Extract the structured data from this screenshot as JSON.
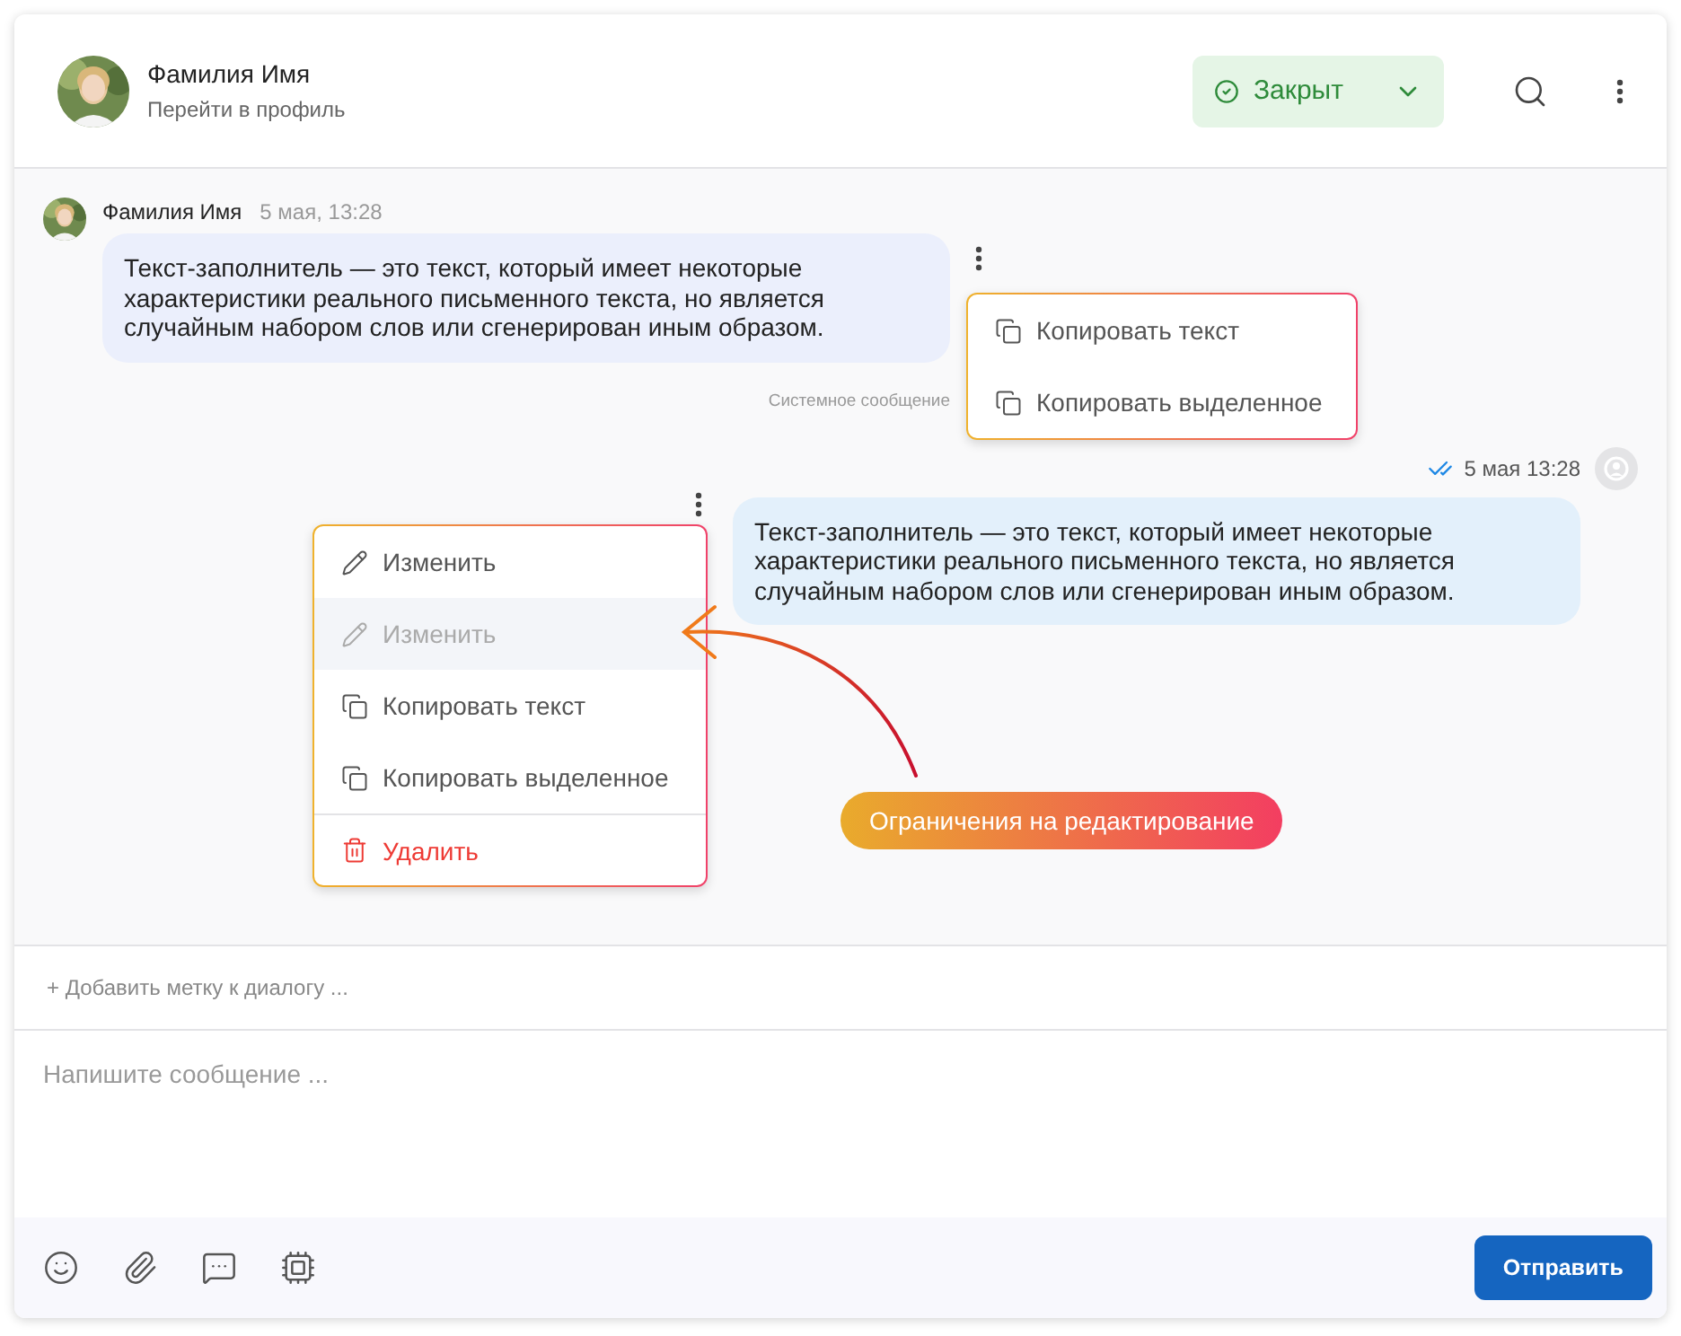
{
  "header": {
    "name": "Фамилия Имя",
    "profile_link": "Перейти в профиль",
    "status": "Закрыт"
  },
  "messages": [
    {
      "kind": "incoming",
      "author": "Фамилия Имя",
      "time": "5 мая, 13:28",
      "text": "Текст-заполнитель — это текст, который имеет некоторые характеристики реального письменного текста, но является случайным набором слов или сгенерирован иным образом.",
      "note": "Системное сообщение"
    },
    {
      "kind": "outgoing",
      "time": "5 мая 13:28",
      "text": "Текст-заполнитель — это текст, который имеет некоторые характеристики реального письменного текста, но является случайным набором слов или сгенерирован иным образом."
    }
  ],
  "menus": [
    {
      "items": [
        {
          "label": "Копировать текст",
          "kind": "copy",
          "disabled": false
        },
        {
          "label": "Копировать выделенное",
          "kind": "copy",
          "disabled": false
        }
      ]
    },
    {
      "items": [
        {
          "label": "Изменить",
          "kind": "edit",
          "disabled": false
        },
        {
          "label": "Изменить",
          "kind": "edit",
          "disabled": true
        },
        {
          "label": "Копировать текст",
          "kind": "copy",
          "disabled": false
        },
        {
          "label": "Копировать выделенное",
          "kind": "copy",
          "disabled": false
        },
        {
          "label": "Удалить",
          "kind": "delete",
          "disabled": false
        }
      ]
    }
  ],
  "annotation": "Ограничения на редактирование",
  "tag_field": {
    "placeholder": "+ Добавить метку к диалогу ..."
  },
  "message_field": {
    "placeholder": "Напишите сообщение ..."
  },
  "send_button": "Отправить"
}
